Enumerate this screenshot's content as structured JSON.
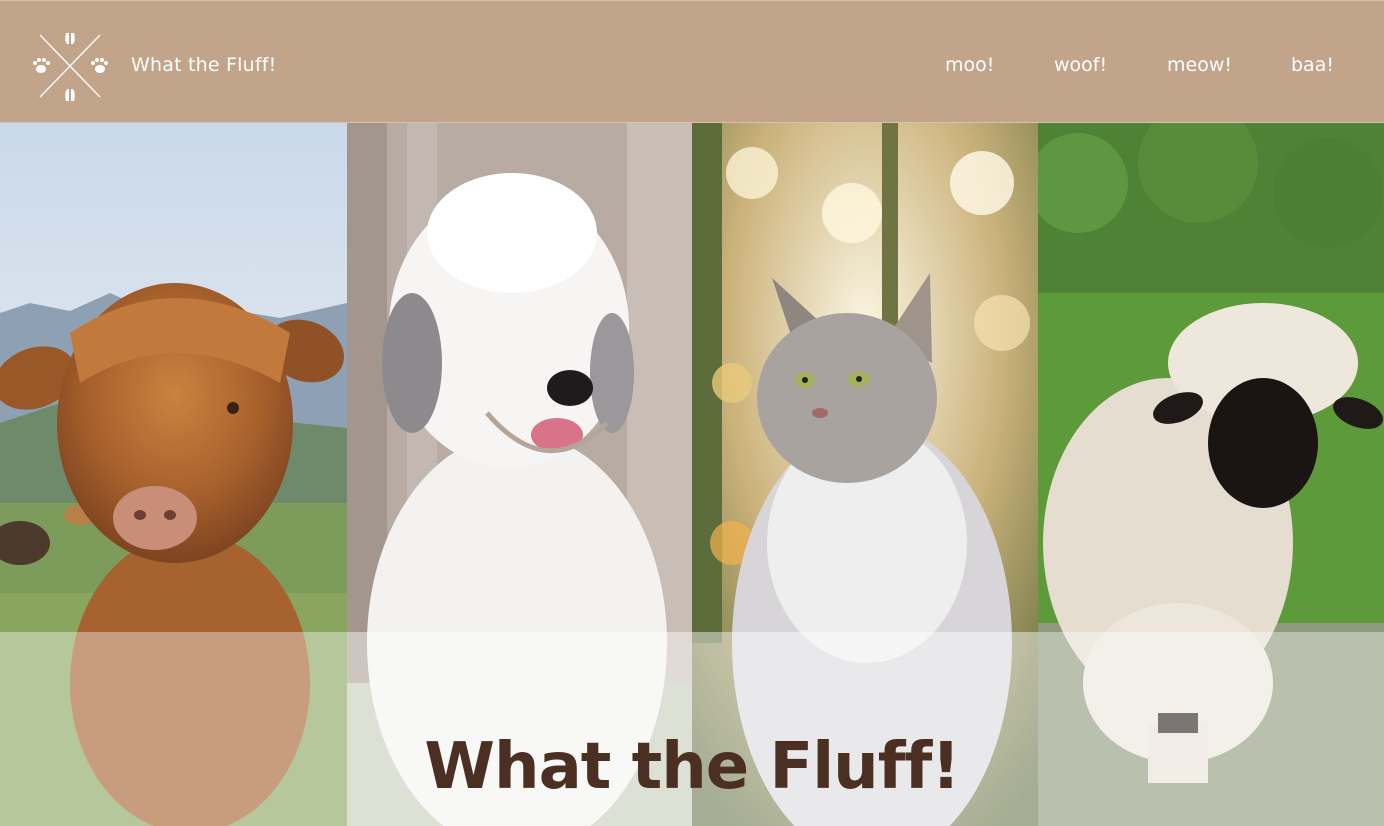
{
  "header": {
    "brand": "What the Fluff!",
    "logo_icon": "paw-hoof-crossed-logo-icon",
    "background": "#c2a48a"
  },
  "nav": {
    "items": [
      {
        "label": "moo!"
      },
      {
        "label": "woof!"
      },
      {
        "label": "meow!"
      },
      {
        "label": "baa!"
      }
    ]
  },
  "hero": {
    "title": "What the Fluff!",
    "title_color": "#4a2f22",
    "panels": [
      {
        "animal": "highland-calf"
      },
      {
        "animal": "old-english-sheepdog"
      },
      {
        "animal": "maine-coon-cat"
      },
      {
        "animal": "valais-blacknose-sheep"
      }
    ]
  }
}
